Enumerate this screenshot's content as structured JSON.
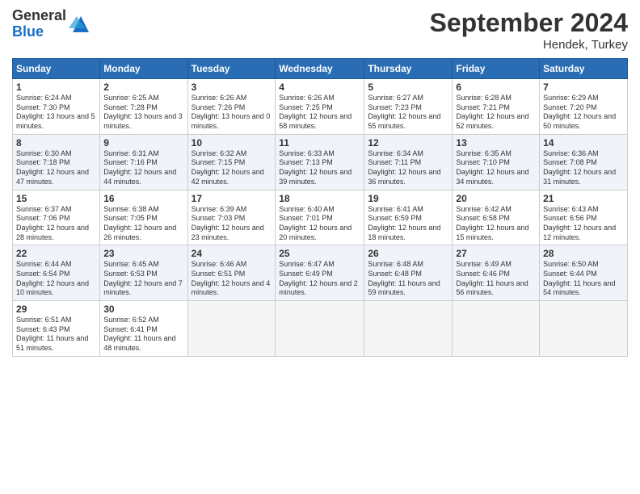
{
  "logo": {
    "general": "General",
    "blue": "Blue"
  },
  "header": {
    "month": "September 2024",
    "location": "Hendek, Turkey"
  },
  "columns": [
    "Sunday",
    "Monday",
    "Tuesday",
    "Wednesday",
    "Thursday",
    "Friday",
    "Saturday"
  ],
  "weeks": [
    [
      {
        "day": "1",
        "sunrise": "6:24 AM",
        "sunset": "7:30 PM",
        "daylight": "13 hours and 5 minutes."
      },
      {
        "day": "2",
        "sunrise": "6:25 AM",
        "sunset": "7:28 PM",
        "daylight": "13 hours and 3 minutes."
      },
      {
        "day": "3",
        "sunrise": "6:26 AM",
        "sunset": "7:26 PM",
        "daylight": "13 hours and 0 minutes."
      },
      {
        "day": "4",
        "sunrise": "6:26 AM",
        "sunset": "7:25 PM",
        "daylight": "12 hours and 58 minutes."
      },
      {
        "day": "5",
        "sunrise": "6:27 AM",
        "sunset": "7:23 PM",
        "daylight": "12 hours and 55 minutes."
      },
      {
        "day": "6",
        "sunrise": "6:28 AM",
        "sunset": "7:21 PM",
        "daylight": "12 hours and 52 minutes."
      },
      {
        "day": "7",
        "sunrise": "6:29 AM",
        "sunset": "7:20 PM",
        "daylight": "12 hours and 50 minutes."
      }
    ],
    [
      {
        "day": "8",
        "sunrise": "6:30 AM",
        "sunset": "7:18 PM",
        "daylight": "12 hours and 47 minutes."
      },
      {
        "day": "9",
        "sunrise": "6:31 AM",
        "sunset": "7:16 PM",
        "daylight": "12 hours and 44 minutes."
      },
      {
        "day": "10",
        "sunrise": "6:32 AM",
        "sunset": "7:15 PM",
        "daylight": "12 hours and 42 minutes."
      },
      {
        "day": "11",
        "sunrise": "6:33 AM",
        "sunset": "7:13 PM",
        "daylight": "12 hours and 39 minutes."
      },
      {
        "day": "12",
        "sunrise": "6:34 AM",
        "sunset": "7:11 PM",
        "daylight": "12 hours and 36 minutes."
      },
      {
        "day": "13",
        "sunrise": "6:35 AM",
        "sunset": "7:10 PM",
        "daylight": "12 hours and 34 minutes."
      },
      {
        "day": "14",
        "sunrise": "6:36 AM",
        "sunset": "7:08 PM",
        "daylight": "12 hours and 31 minutes."
      }
    ],
    [
      {
        "day": "15",
        "sunrise": "6:37 AM",
        "sunset": "7:06 PM",
        "daylight": "12 hours and 28 minutes."
      },
      {
        "day": "16",
        "sunrise": "6:38 AM",
        "sunset": "7:05 PM",
        "daylight": "12 hours and 26 minutes."
      },
      {
        "day": "17",
        "sunrise": "6:39 AM",
        "sunset": "7:03 PM",
        "daylight": "12 hours and 23 minutes."
      },
      {
        "day": "18",
        "sunrise": "6:40 AM",
        "sunset": "7:01 PM",
        "daylight": "12 hours and 20 minutes."
      },
      {
        "day": "19",
        "sunrise": "6:41 AM",
        "sunset": "6:59 PM",
        "daylight": "12 hours and 18 minutes."
      },
      {
        "day": "20",
        "sunrise": "6:42 AM",
        "sunset": "6:58 PM",
        "daylight": "12 hours and 15 minutes."
      },
      {
        "day": "21",
        "sunrise": "6:43 AM",
        "sunset": "6:56 PM",
        "daylight": "12 hours and 12 minutes."
      }
    ],
    [
      {
        "day": "22",
        "sunrise": "6:44 AM",
        "sunset": "6:54 PM",
        "daylight": "12 hours and 10 minutes."
      },
      {
        "day": "23",
        "sunrise": "6:45 AM",
        "sunset": "6:53 PM",
        "daylight": "12 hours and 7 minutes."
      },
      {
        "day": "24",
        "sunrise": "6:46 AM",
        "sunset": "6:51 PM",
        "daylight": "12 hours and 4 minutes."
      },
      {
        "day": "25",
        "sunrise": "6:47 AM",
        "sunset": "6:49 PM",
        "daylight": "12 hours and 2 minutes."
      },
      {
        "day": "26",
        "sunrise": "6:48 AM",
        "sunset": "6:48 PM",
        "daylight": "11 hours and 59 minutes."
      },
      {
        "day": "27",
        "sunrise": "6:49 AM",
        "sunset": "6:46 PM",
        "daylight": "11 hours and 56 minutes."
      },
      {
        "day": "28",
        "sunrise": "6:50 AM",
        "sunset": "6:44 PM",
        "daylight": "11 hours and 54 minutes."
      }
    ],
    [
      {
        "day": "29",
        "sunrise": "6:51 AM",
        "sunset": "6:43 PM",
        "daylight": "11 hours and 51 minutes."
      },
      {
        "day": "30",
        "sunrise": "6:52 AM",
        "sunset": "6:41 PM",
        "daylight": "11 hours and 48 minutes."
      },
      null,
      null,
      null,
      null,
      null
    ]
  ]
}
